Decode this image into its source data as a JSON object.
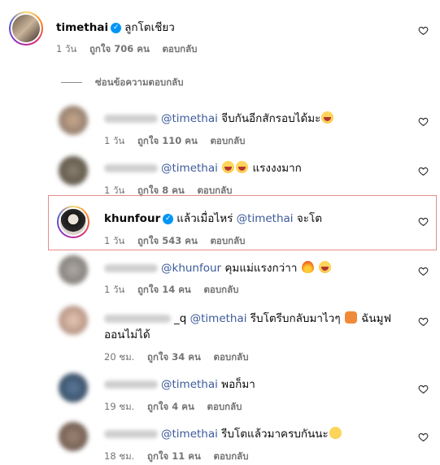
{
  "top_comment": {
    "username": "timethai",
    "text": "ลูกโตเชียว",
    "time": "1 วัน",
    "likes": "ถูกใจ 706 คน",
    "reply": "ตอบกลับ"
  },
  "hide_replies": "ซ่อนข้อความตอบกลับ",
  "replies": [
    {
      "mention": "@timethai",
      "text": "จีบกันอีกสักรอบได้มะ",
      "time": "1 วัน",
      "likes": "ถูกใจ 110 คน",
      "reply": "ตอบกลับ"
    },
    {
      "mention": "@timethai",
      "text": "แรงงงมาก",
      "time": "1 วัน",
      "likes": "ถูกใจ 8 คน",
      "reply": "ตอบกลับ"
    },
    {
      "username": "khunfour",
      "prefix": "แล้วเมื่อไหร่",
      "mention": "@timethai",
      "text": "จะโต",
      "time": "1 วัน",
      "likes": "ถูกใจ 543 คน",
      "reply": "ตอบกลับ"
    },
    {
      "mention": "@khunfour",
      "text": "คุมแม่แรงกว่าา",
      "time": "1 วัน",
      "likes": "ถูกใจ 14 คน",
      "reply": "ตอบกลับ"
    },
    {
      "username_visible": "_q",
      "mention": "@timethai",
      "text": "รีบโตรีบกลับมาไวๆ",
      "text2": "ฉันมูฟ",
      "text3": "ออนไม่ได้",
      "time": "20 ชม.",
      "likes": "ถูกใจ 34 คน",
      "reply": "ตอบกลับ"
    },
    {
      "mention": "@timethai",
      "text": "พอก็มา",
      "time": "19 ชม.",
      "likes": "ถูกใจ 4 คน",
      "reply": "ตอบกลับ"
    },
    {
      "mention": "@timethai",
      "text": "รีบโตแล้วมาครบกันนะ",
      "time": "18 ชม.",
      "likes": "ถูกใจ 11 คน",
      "reply": "ตอบกลับ"
    }
  ],
  "colors": {
    "mention": "#3b5a9a",
    "verified": "#0095f6",
    "highlight": "#e88b8b",
    "meta": "#737373"
  }
}
